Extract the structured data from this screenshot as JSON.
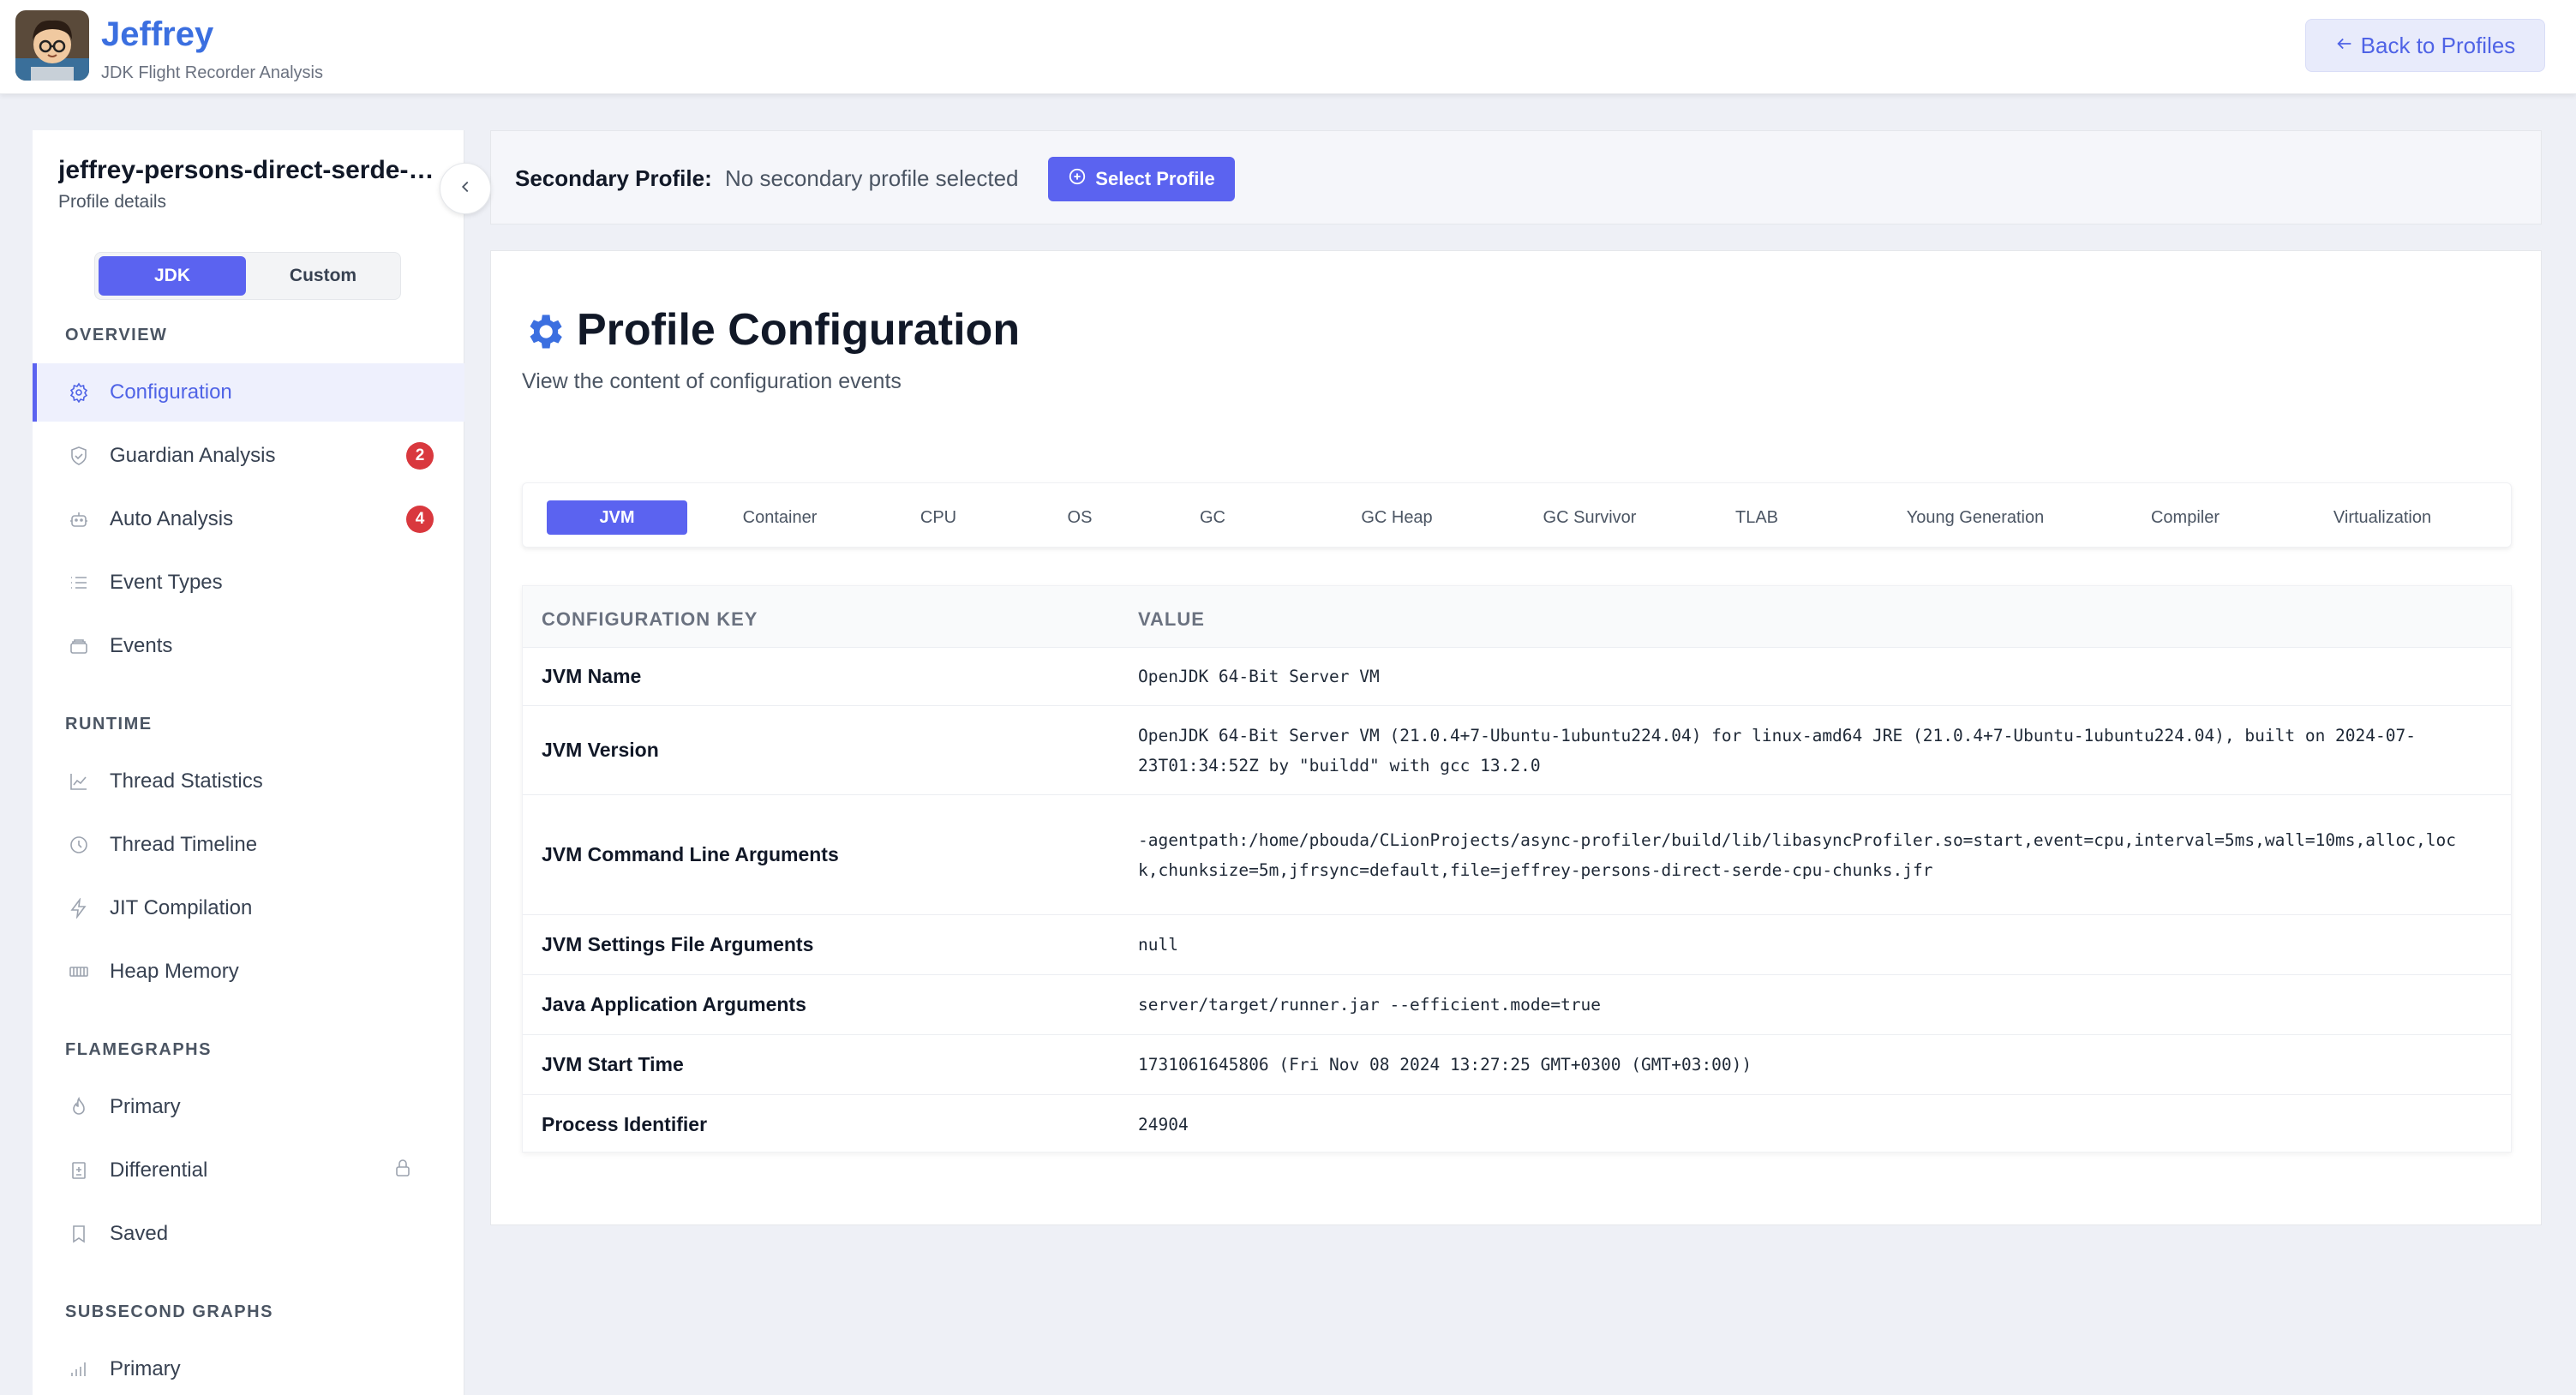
{
  "header": {
    "title": "Jeffrey",
    "subtitle": "JDK Flight Recorder Analysis",
    "back_button": "Back to Profiles"
  },
  "sidebar": {
    "profile_name": "jeffrey-persons-direct-serde-cpu-chunks",
    "profile_sub": "Profile details",
    "toggle": {
      "jdk": "JDK",
      "custom": "Custom"
    },
    "sections": {
      "overview": "OVERVIEW",
      "runtime": "RUNTIME",
      "flamegraphs": "FLAMEGRAPHS",
      "subsecond": "SUBSECOND GRAPHS"
    },
    "items": {
      "configuration": "Configuration",
      "guardian": "Guardian Analysis",
      "guardian_badge": "2",
      "auto": "Auto Analysis",
      "auto_badge": "4",
      "event_types": "Event Types",
      "events": "Events",
      "thread_stats": "Thread Statistics",
      "thread_timeline": "Thread Timeline",
      "jit": "JIT Compilation",
      "heap": "Heap Memory",
      "fg_primary": "Primary",
      "fg_differential": "Differential",
      "fg_saved": "Saved",
      "ss_primary": "Primary"
    }
  },
  "secondary": {
    "label": "Secondary Profile:",
    "value": "No secondary profile selected",
    "button": "Select Profile"
  },
  "main": {
    "title": "Profile Configuration",
    "subtitle": "View the content of configuration events",
    "tabs": [
      "JVM",
      "Container",
      "CPU",
      "OS",
      "GC",
      "GC Heap",
      "GC Survivor",
      "TLAB",
      "Young Generation",
      "Compiler",
      "Virtualization"
    ],
    "table": {
      "col_key": "CONFIGURATION KEY",
      "col_value": "VALUE",
      "rows": [
        {
          "key": "JVM Name",
          "value": "OpenJDK 64-Bit Server VM"
        },
        {
          "key": "JVM Version",
          "value": "OpenJDK 64-Bit Server VM (21.0.4+7-Ubuntu-1ubuntu224.04) for linux-amd64 JRE (21.0.4+7-Ubuntu-1ubuntu224.04), built on 2024-07-23T01:34:52Z by \"buildd\" with gcc 13.2.0"
        },
        {
          "key": "JVM Command Line Arguments",
          "value": "-agentpath:/home/pbouda/CLionProjects/async-profiler/build/lib/libasyncProfiler.so=start,event=cpu,interval=5ms,wall=10ms,alloc,lock,chunksize=5m,jfrsync=default,file=jeffrey-persons-direct-serde-cpu-chunks.jfr"
        },
        {
          "key": "JVM Settings File Arguments",
          "value": "null"
        },
        {
          "key": "Java Application Arguments",
          "value": "server/target/runner.jar --efficient.mode=true"
        },
        {
          "key": "JVM Start Time",
          "value": "1731061645806 (Fri Nov 08 2024 13:27:25 GMT+0300 (GMT+03:00))"
        },
        {
          "key": "Process Identifier",
          "value": "24904"
        }
      ]
    }
  },
  "colors": {
    "accent": "#5b63f0",
    "brand": "#3b6fe0",
    "badge": "#d9383e"
  }
}
